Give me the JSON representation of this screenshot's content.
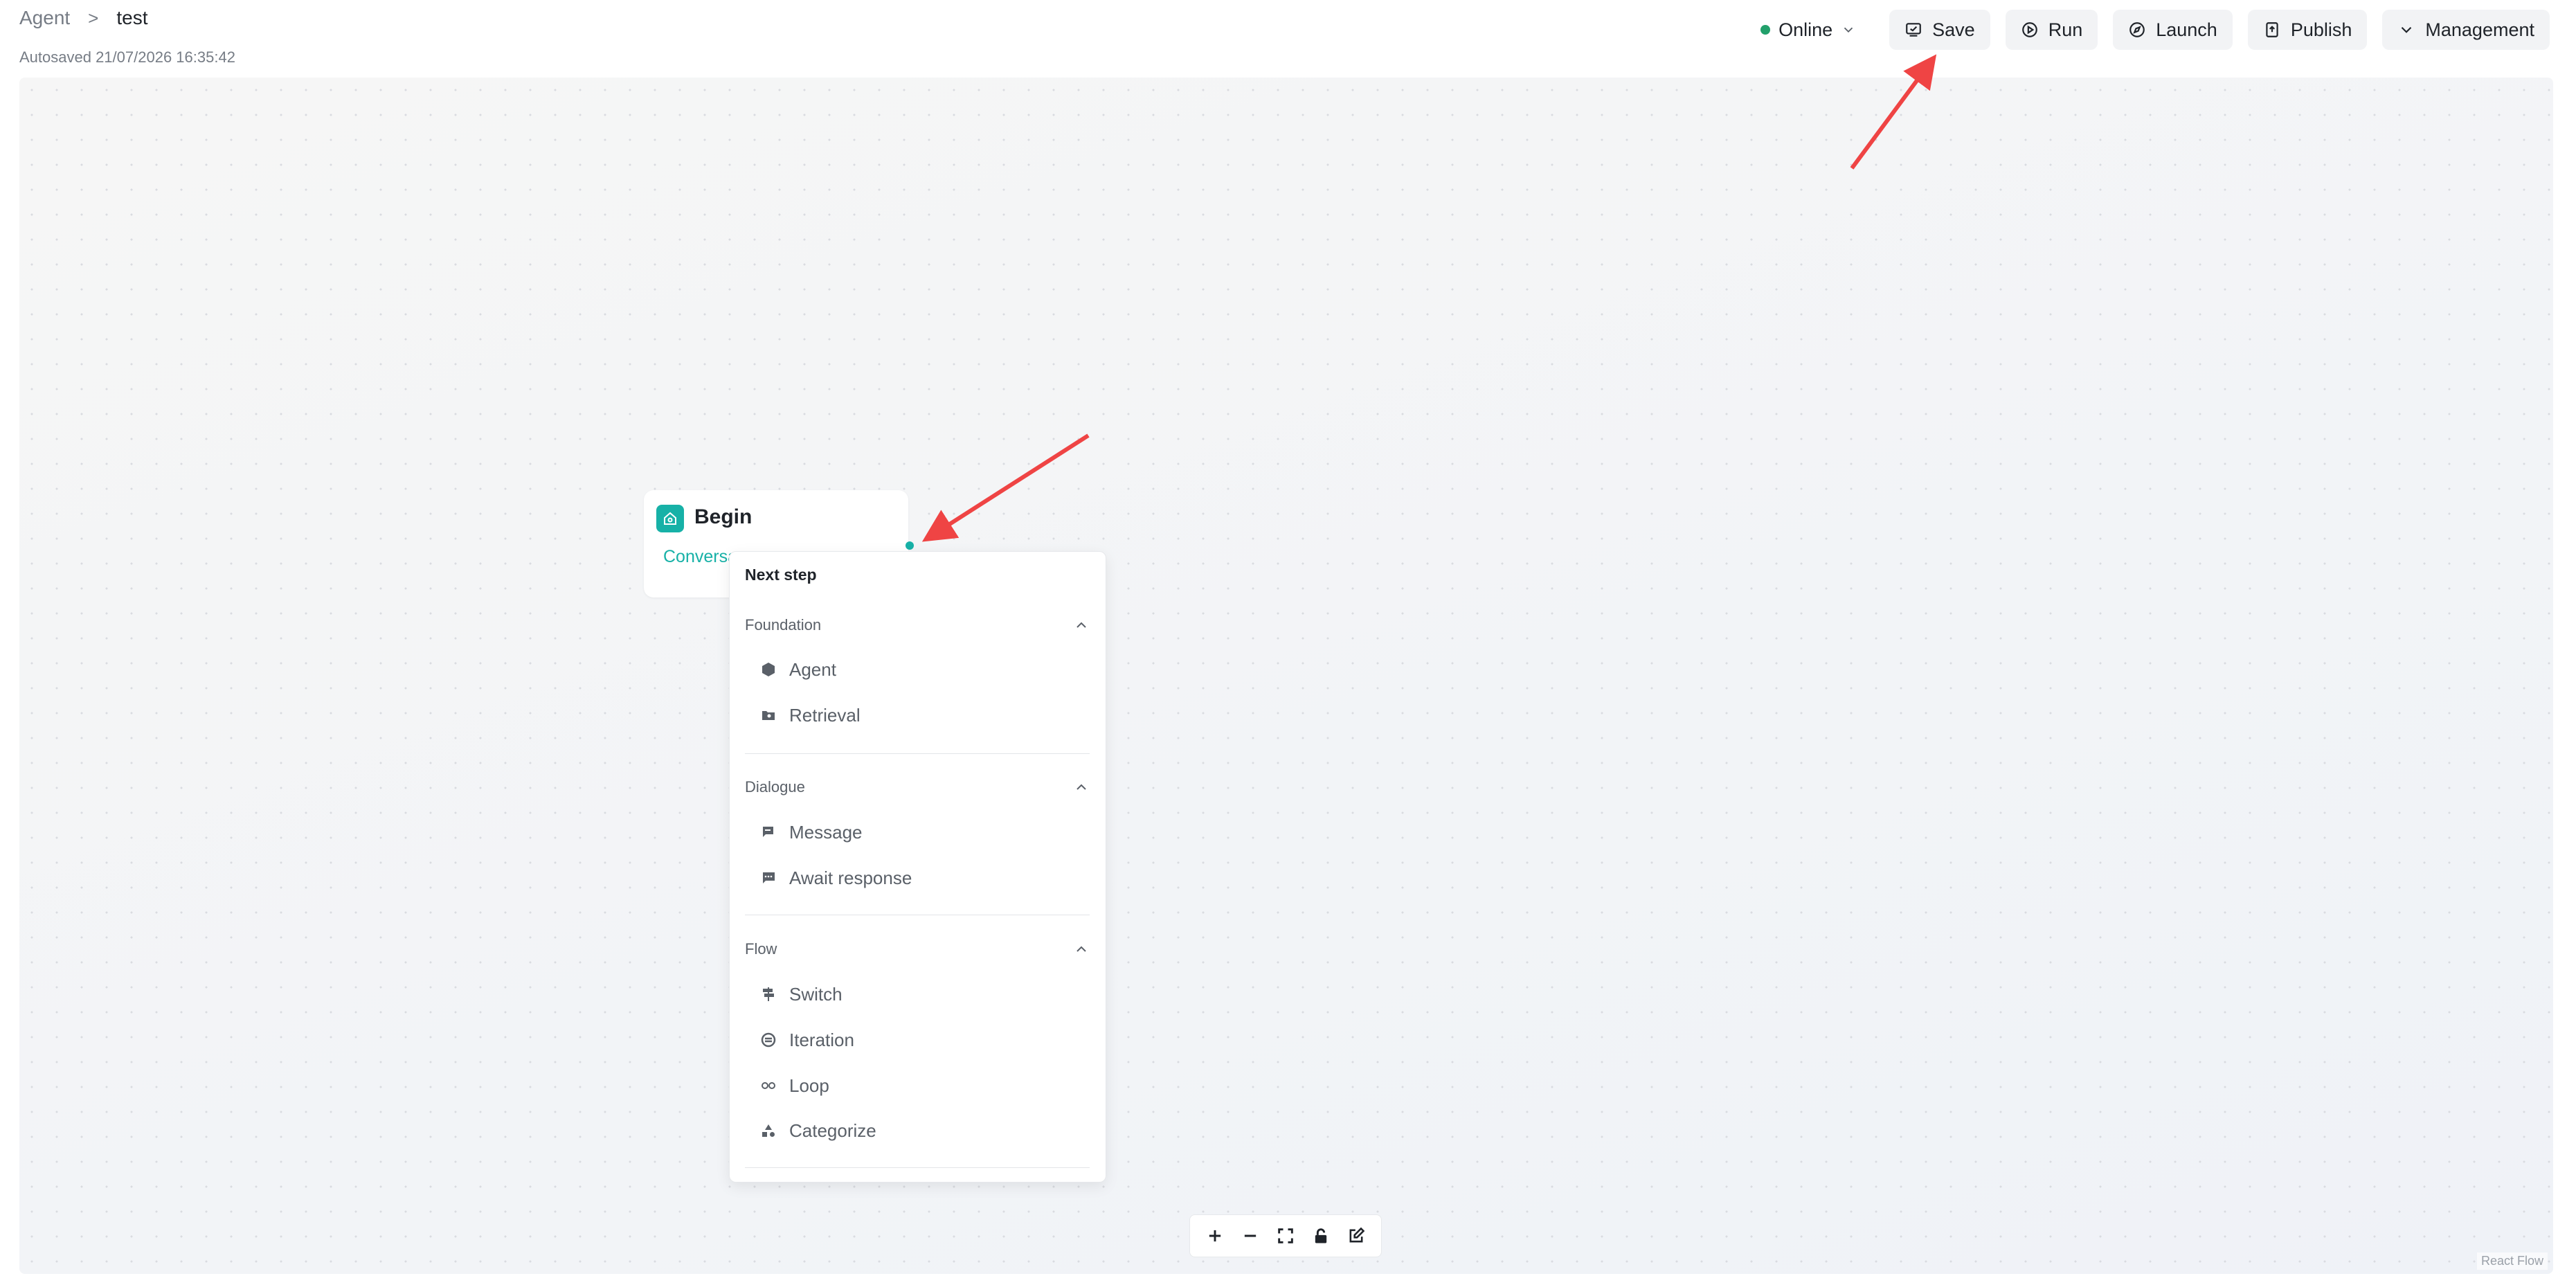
{
  "breadcrumb": {
    "parent": "Agent",
    "separator": ">",
    "current": "test"
  },
  "autosave": "Autosaved 21/07/2026 16:35:42",
  "toolbar": {
    "status": "Online",
    "status_color": "#22a06b",
    "buttons": {
      "save": "Save",
      "run": "Run",
      "launch": "Launch",
      "publish": "Publish",
      "management": "Management"
    }
  },
  "node": {
    "title": "Begin",
    "tag": "Conversational"
  },
  "next_step_menu": {
    "title": "Next step",
    "sections": [
      {
        "label": "Foundation",
        "items": [
          "Agent",
          "Retrieval"
        ]
      },
      {
        "label": "Dialogue",
        "items": [
          "Message",
          "Await response"
        ]
      },
      {
        "label": "Flow",
        "items": [
          "Switch",
          "Iteration",
          "Loop",
          "Categorize"
        ]
      }
    ]
  },
  "canvas": {
    "attribution": "React Flow"
  },
  "colors": {
    "accent": "#17b1a7",
    "annotation_arrow": "#ef4444"
  }
}
